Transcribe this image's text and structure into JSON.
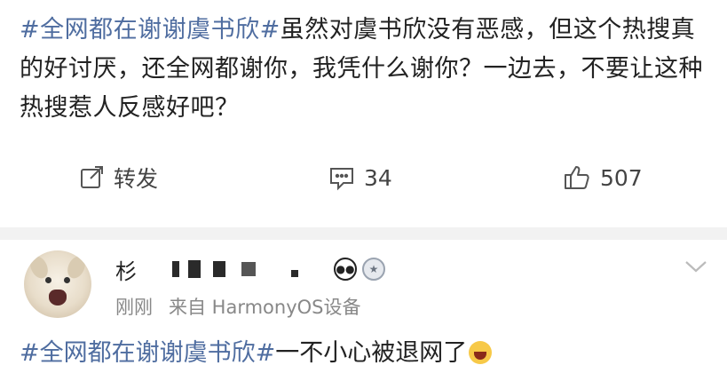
{
  "post": {
    "hashtag": "#全网都在谢谢虞书欣#",
    "body": "虽然对虞书欣没有恶感，但这个热搜真的好讨厌，还全网都谢你，我凭什么谢你？一边去，不要让这种热搜惹人反感好吧？"
  },
  "actions": {
    "repost_label": "转发",
    "comment_count": "34",
    "like_count": "507"
  },
  "comment": {
    "username": "杉",
    "time": "刚刚",
    "source": "来自 HarmonyOS设备",
    "hashtag": "#全网都在谢谢虞书欣#",
    "text": "一不小心被退网了"
  },
  "icons": {
    "repost": "repost-icon",
    "comment": "comment-icon",
    "like": "thumbs-up-icon",
    "more": "chevron-down-icon"
  },
  "colors": {
    "hashtag": "#4f6da0",
    "meta": "#888888"
  }
}
